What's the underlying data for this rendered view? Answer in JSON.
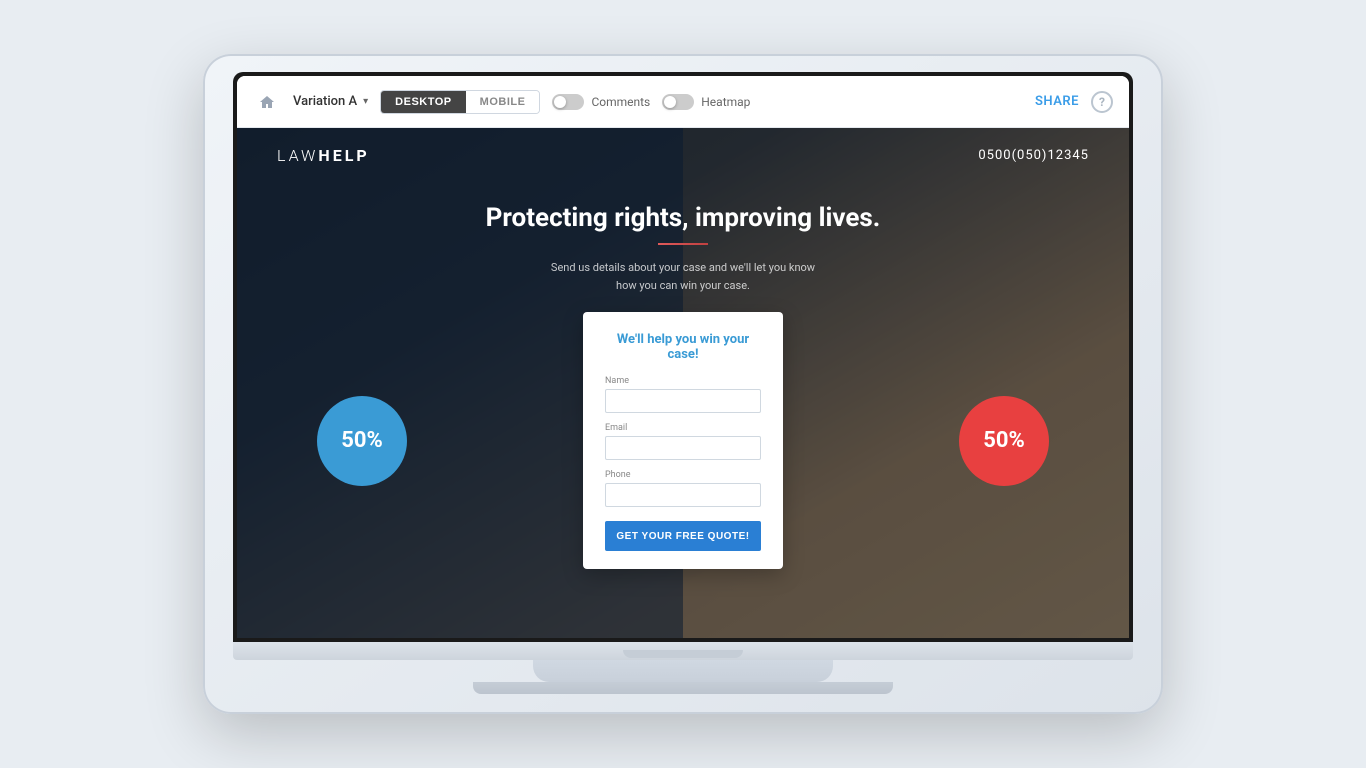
{
  "toolbar": {
    "home_icon": "🏠",
    "variation_label": "Variation A",
    "dropdown_arrow": "▾",
    "desktop_tab": "DESKTOP",
    "mobile_tab": "MOBILE",
    "comments_label": "Comments",
    "heatmap_label": "Heatmap",
    "share_label": "SHARE",
    "help_label": "?"
  },
  "landing": {
    "logo_text_light": "LAW",
    "logo_text_bold": "HELP",
    "phone": "0500(050)12345",
    "hero_title": "Protecting rights, improving lives.",
    "hero_subtitle_line1": "Send us details about your case and we'll let you know",
    "hero_subtitle_line2": "how you can win your case.",
    "form_headline": "We'll help you win your case!",
    "name_label": "Name",
    "email_label": "Email",
    "phone_label": "Phone",
    "submit_label": "GET YOUR FREE QUOTE!",
    "bubble_left_percent": "50%",
    "bubble_right_percent": "50%"
  },
  "colors": {
    "accent_blue": "#3a9bd5",
    "accent_red": "#e84040",
    "submit_blue": "#2a7fd4",
    "toolbar_border": "#e5e9ee"
  }
}
